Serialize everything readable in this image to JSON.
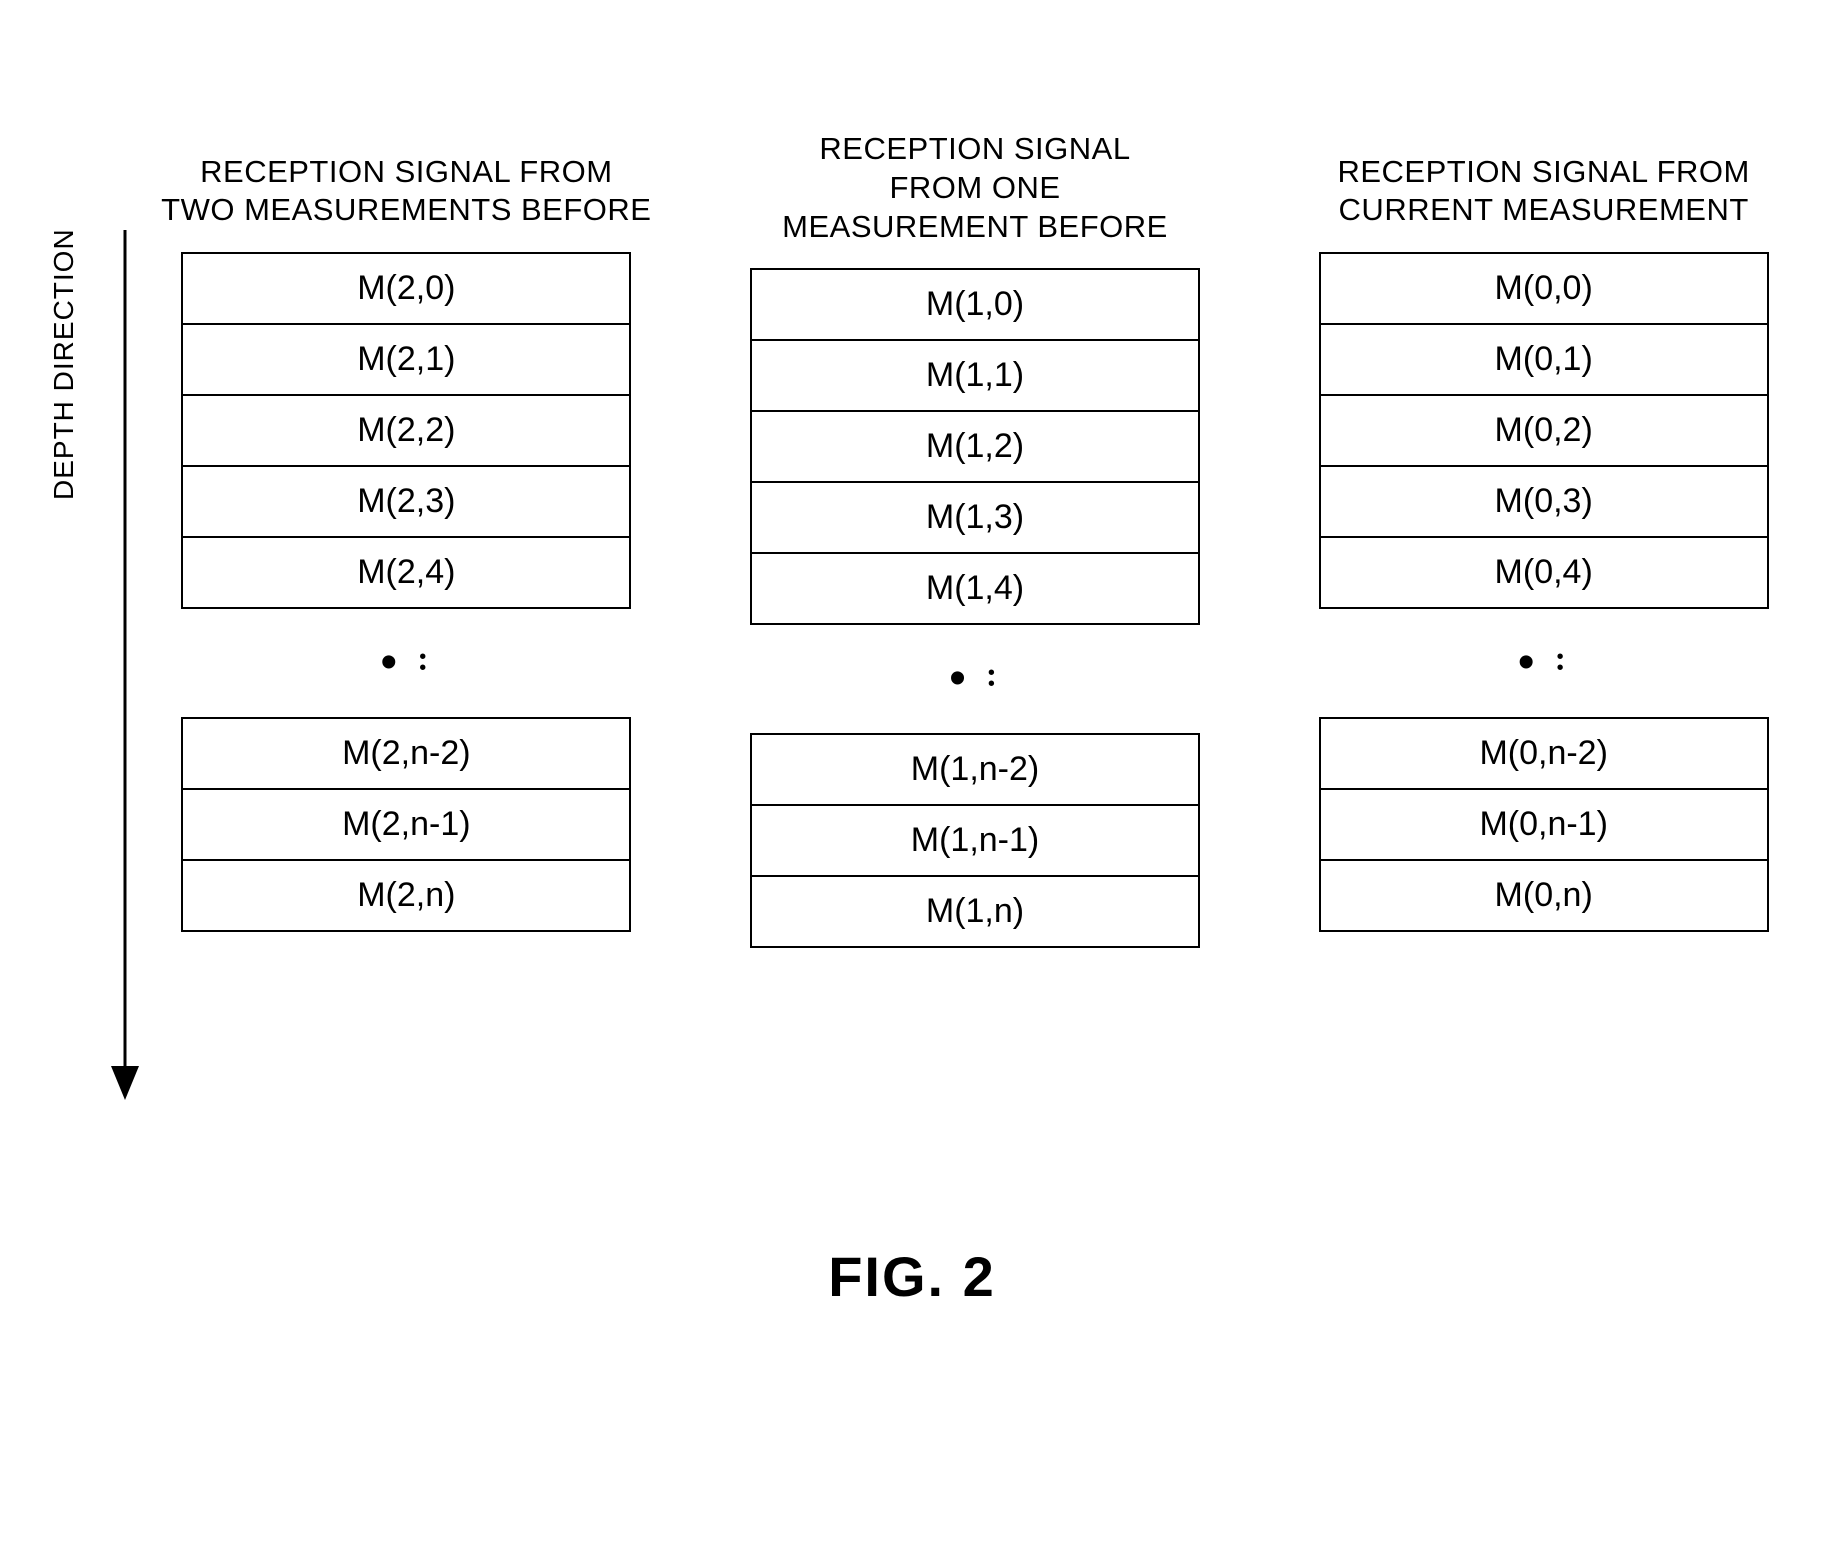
{
  "depth_label": "DEPTH DIRECTION",
  "columns": [
    {
      "header": "RECEPTION SIGNAL FROM\nTWO MEASUREMENTS BEFORE",
      "top": [
        "M(2,0)",
        "M(2,1)",
        "M(2,2)",
        "M(2,3)",
        "M(2,4)"
      ],
      "bottom": [
        "M(2,n-2)",
        "M(2,n-1)",
        "M(2,n)"
      ]
    },
    {
      "header": "RECEPTION SIGNAL\nFROM ONE\nMEASUREMENT BEFORE",
      "top": [
        "M(1,0)",
        "M(1,1)",
        "M(1,2)",
        "M(1,3)",
        "M(1,4)"
      ],
      "bottom": [
        "M(1,n-2)",
        "M(1,n-1)",
        "M(1,n)"
      ]
    },
    {
      "header": "RECEPTION SIGNAL FROM\nCURRENT MEASUREMENT",
      "top": [
        "M(0,0)",
        "M(0,1)",
        "M(0,2)",
        "M(0,3)",
        "M(0,4)"
      ],
      "bottom": [
        "M(0,n-2)",
        "M(0,n-1)",
        "M(0,n)"
      ]
    }
  ],
  "ellipsis": "•",
  "figure_caption": "FIG. 2"
}
